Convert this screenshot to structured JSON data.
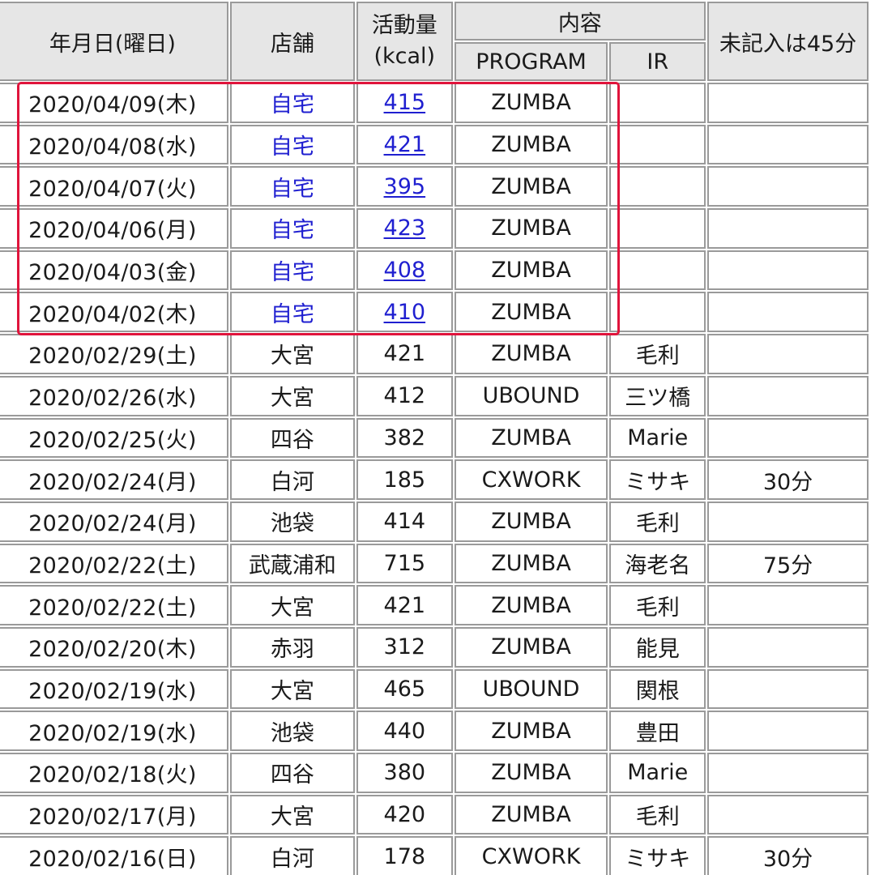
{
  "table": {
    "headers": {
      "date": "年月日(曜日)",
      "store": "店舗",
      "kcal_line1": "活動量",
      "kcal_line2": "(kcal)",
      "content": "内容",
      "program": "PROGRAM",
      "ir": "IR",
      "note": "未記入は45分"
    },
    "rows": [
      {
        "date": "2020/04/09(木)",
        "store": "自宅",
        "kcal": "415",
        "program": "ZUMBA",
        "ir": "",
        "note": ""
      },
      {
        "date": "2020/04/08(水)",
        "store": "自宅",
        "kcal": "421",
        "program": "ZUMBA",
        "ir": "",
        "note": ""
      },
      {
        "date": "2020/04/07(火)",
        "store": "自宅",
        "kcal": "395",
        "program": "ZUMBA",
        "ir": "",
        "note": ""
      },
      {
        "date": "2020/04/06(月)",
        "store": "自宅",
        "kcal": "423",
        "program": "ZUMBA",
        "ir": "",
        "note": ""
      },
      {
        "date": "2020/04/03(金)",
        "store": "自宅",
        "kcal": "408",
        "program": "ZUMBA",
        "ir": "",
        "note": ""
      },
      {
        "date": "2020/04/02(木)",
        "store": "自宅",
        "kcal": "410",
        "program": "ZUMBA",
        "ir": "",
        "note": ""
      },
      {
        "date": "2020/02/29(土)",
        "store": "大宮",
        "kcal": "421",
        "program": "ZUMBA",
        "ir": "毛利",
        "note": ""
      },
      {
        "date": "2020/02/26(水)",
        "store": "大宮",
        "kcal": "412",
        "program": "UBOUND",
        "ir": "三ツ橋",
        "note": ""
      },
      {
        "date": "2020/02/25(火)",
        "store": "四谷",
        "kcal": "382",
        "program": "ZUMBA",
        "ir": "Marie",
        "note": ""
      },
      {
        "date": "2020/02/24(月)",
        "store": "白河",
        "kcal": "185",
        "program": "CXWORK",
        "ir": "ミサキ",
        "note": "30分"
      },
      {
        "date": "2020/02/24(月)",
        "store": "池袋",
        "kcal": "414",
        "program": "ZUMBA",
        "ir": "毛利",
        "note": ""
      },
      {
        "date": "2020/02/22(土)",
        "store": "武蔵浦和",
        "kcal": "715",
        "program": "ZUMBA",
        "ir": "海老名",
        "note": "75分"
      },
      {
        "date": "2020/02/22(土)",
        "store": "大宮",
        "kcal": "421",
        "program": "ZUMBA",
        "ir": "毛利",
        "note": ""
      },
      {
        "date": "2020/02/20(木)",
        "store": "赤羽",
        "kcal": "312",
        "program": "ZUMBA",
        "ir": "能見",
        "note": ""
      },
      {
        "date": "2020/02/19(水)",
        "store": "大宮",
        "kcal": "465",
        "program": "UBOUND",
        "ir": "関根",
        "note": ""
      },
      {
        "date": "2020/02/19(水)",
        "store": "池袋",
        "kcal": "440",
        "program": "ZUMBA",
        "ir": "豊田",
        "note": ""
      },
      {
        "date": "2020/02/18(火)",
        "store": "四谷",
        "kcal": "380",
        "program": "ZUMBA",
        "ir": "Marie",
        "note": ""
      },
      {
        "date": "2020/02/17(月)",
        "store": "大宮",
        "kcal": "420",
        "program": "ZUMBA",
        "ir": "毛利",
        "note": ""
      },
      {
        "date": "2020/02/16(日)",
        "store": "白河",
        "kcal": "178",
        "program": "CXWORK",
        "ir": "ミサキ",
        "note": "30分"
      }
    ]
  },
  "colors": {
    "link": "#1f1fd0",
    "highlight": "#e0143c",
    "header_bg": "#e6e6e6",
    "border": "#9a9a9a"
  }
}
